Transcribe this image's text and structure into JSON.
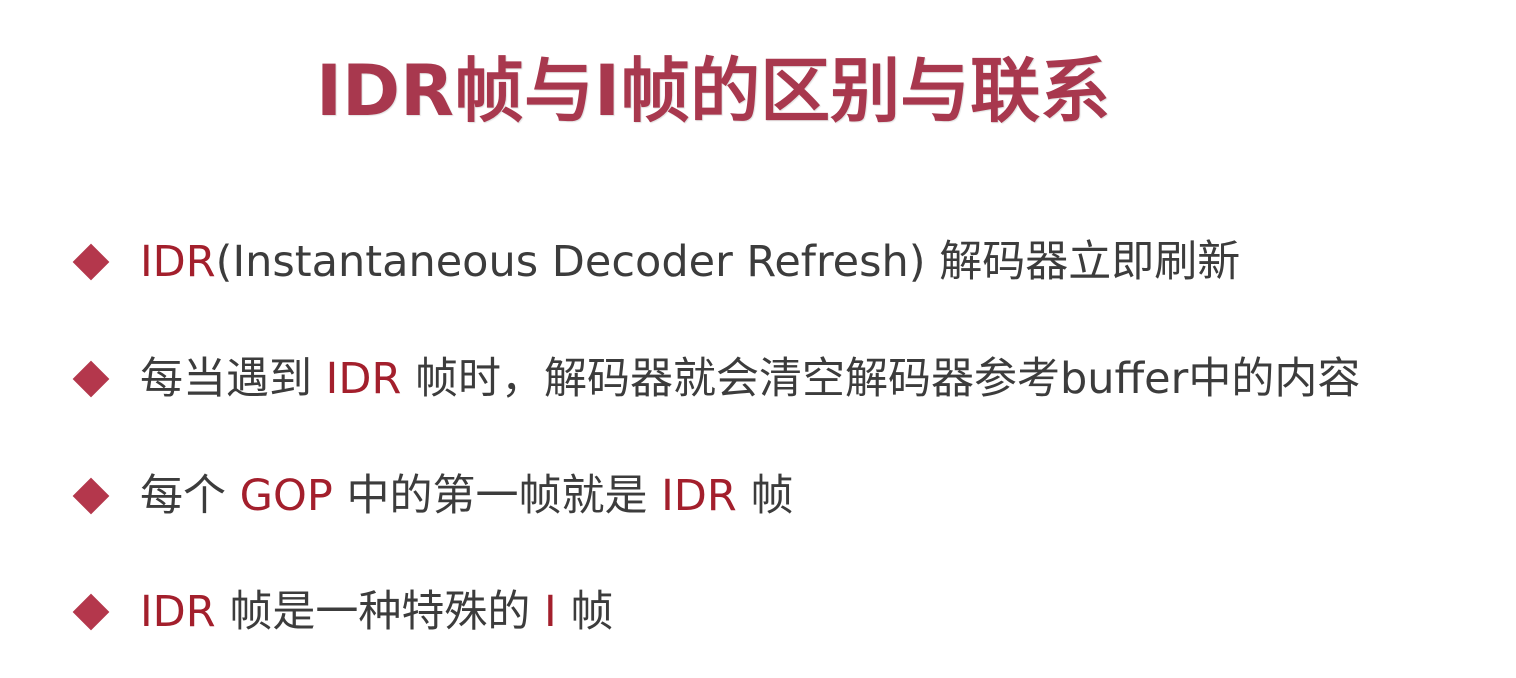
{
  "title": "IDR帧与I帧的区别与联系",
  "accent_color": "#a31f2c",
  "bullet_color": "#b4374c",
  "bullets": [
    {
      "marker_icon": "diamond-bullet-icon",
      "parts": [
        {
          "text": "IDR",
          "highlight": true
        },
        {
          "text": "(Instantaneous Decoder Refresh) 解码器立即刷新",
          "highlight": false
        }
      ]
    },
    {
      "marker_icon": "diamond-bullet-icon",
      "parts": [
        {
          "text": "每当遇到 ",
          "highlight": false
        },
        {
          "text": "IDR",
          "highlight": true
        },
        {
          "text": " 帧时，解码器就会清空解码器参考buffer中的内容",
          "highlight": false
        }
      ]
    },
    {
      "marker_icon": "diamond-bullet-icon",
      "parts": [
        {
          "text": "每个 ",
          "highlight": false
        },
        {
          "text": "GOP",
          "highlight": true
        },
        {
          "text": " 中的第一帧就是 ",
          "highlight": false
        },
        {
          "text": "IDR",
          "highlight": true
        },
        {
          "text": " 帧",
          "highlight": false
        }
      ]
    },
    {
      "marker_icon": "diamond-bullet-icon",
      "parts": [
        {
          "text": "IDR",
          "highlight": true
        },
        {
          "text": " 帧是一种特殊的 ",
          "highlight": false
        },
        {
          "text": "I",
          "highlight": true
        },
        {
          "text": " 帧",
          "highlight": false
        }
      ]
    }
  ]
}
